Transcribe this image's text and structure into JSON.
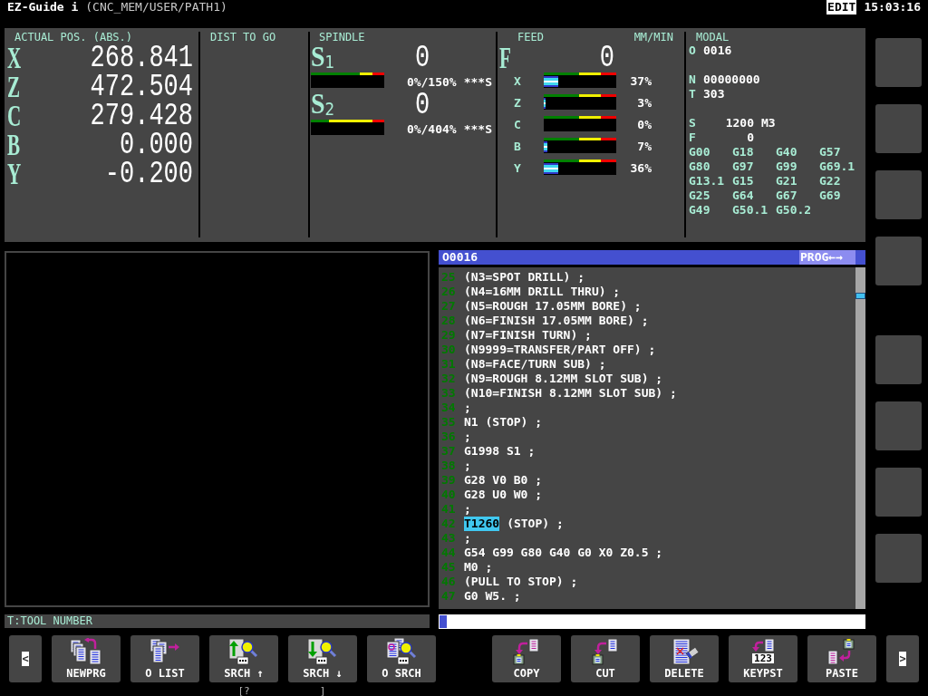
{
  "header": {
    "title": "EZ-Guide i",
    "path": "(CNC_MEM/USER/PATH1)",
    "mode": "EDIT",
    "time": "15:03:16"
  },
  "position": {
    "title": "ACTUAL POS. (ABS.)",
    "axes": [
      {
        "axis": "X",
        "value": "268.841"
      },
      {
        "axis": "Z",
        "value": "472.504"
      },
      {
        "axis": "C",
        "value": "279.428"
      },
      {
        "axis": "B",
        "value": "0.000"
      },
      {
        "axis": "Y",
        "value": "-0.200"
      }
    ]
  },
  "distance_to_go": {
    "title": "DIST TO GO"
  },
  "spindle": {
    "title": "SPINDLE",
    "spindles": [
      {
        "label": "S$_{1}$",
        "speed": "0",
        "load": "0%/150%",
        "status": "***S"
      },
      {
        "label": "S$_{2}$",
        "speed": "0",
        "load": "0%/404%",
        "status": "***S"
      }
    ]
  },
  "feed": {
    "title": "FEED",
    "unit": "MM/MIN",
    "label": "F",
    "value": "0",
    "axes": [
      {
        "axis": "X",
        "level": 0.2,
        "percent": "37%"
      },
      {
        "axis": "Z",
        "level": 0.025,
        "percent": "3%"
      },
      {
        "axis": "C",
        "percent": "0%"
      },
      {
        "axis": "B",
        "level": 0.05,
        "percent": "7%"
      },
      {
        "axis": "Y",
        "level": 0.2,
        "percent": "36%"
      }
    ]
  },
  "modal": {
    "title": "MODAL",
    "blocks": [
      {
        "lines": [
          {
            "kind": "address",
            "address": "O",
            "value": "0016"
          }
        ]
      },
      {
        "lines": [
          {
            "kind": "address",
            "address": "N",
            "value": "00000000"
          },
          {
            "kind": "address",
            "address": "T",
            "value": "303"
          }
        ]
      },
      {
        "lines": [
          {
            "kind": "command",
            "address": "S",
            "value": "1200",
            "code": "M3"
          },
          {
            "kind": "command",
            "address": "F",
            "value": "0"
          }
        ]
      }
    ],
    "g_codes": [
      "G00",
      "G18",
      "G40",
      "G57",
      "G80",
      "G97",
      "G99",
      "G69.1",
      "G13.1",
      "G15",
      "G21",
      "G22",
      "G25",
      "G64",
      "G67",
      "G69",
      "G49",
      "G50.1",
      "G50.2"
    ]
  },
  "program": {
    "title": "O0016",
    "mode": "PROG←→",
    "lines": [
      {
        "number": "25",
        "text": "(N3=SPOT DRILL) ;"
      },
      {
        "number": "26",
        "text": "(N4=16MM DRILL THRU) ;"
      },
      {
        "number": "27",
        "text": "(N5=ROUGH 17.05MM BORE) ;"
      },
      {
        "number": "28",
        "text": "(N6=FINISH 17.05MM BORE) ;"
      },
      {
        "number": "29",
        "text": "(N7=FINISH TURN) ;"
      },
      {
        "number": "30",
        "text": "(N9999=TRANSFER/PART OFF) ;"
      },
      {
        "number": "31",
        "text": "(N8=FACE/TURN SUB) ;"
      },
      {
        "number": "32",
        "text": "(N9=ROUGH 8.12MM SLOT SUB) ;"
      },
      {
        "number": "33",
        "text": "(N10=FINISH 8.12MM SLOT SUB) ;"
      },
      {
        "number": "34",
        "text": ";"
      },
      {
        "number": "35",
        "text": "N1 (STOP) ;"
      },
      {
        "number": "36",
        "text": ";"
      },
      {
        "number": "37",
        "text": "G1998 S1 ;"
      },
      {
        "number": "38",
        "text": ";"
      },
      {
        "number": "39",
        "text": "G28 V0 B0 ;"
      },
      {
        "number": "40",
        "text": "G28 U0 W0 ;"
      },
      {
        "number": "41",
        "text": ";"
      },
      {
        "number": "42",
        "highlight": "T1260",
        "text": "(STOP) ;"
      },
      {
        "number": "43",
        "text": ";"
      },
      {
        "number": "44",
        "text": "G54 G99 G80 G40 G0 X0 Z0.5 ;"
      },
      {
        "number": "45",
        "text": "M0 ;"
      },
      {
        "number": "46",
        "text": "(PULL TO STOP) ;"
      },
      {
        "number": "47",
        "text": "G0 W5. ;"
      }
    ]
  },
  "message": "T:TOOL NUMBER",
  "side_keys": {
    "upper": [
      {
        "kind": "blank"
      },
      {
        "kind": "blank"
      },
      {
        "kind": "blank"
      },
      {
        "kind": "blank"
      }
    ],
    "lower": [
      {
        "kind": "blank"
      },
      {
        "kind": "blank"
      },
      {
        "kind": "blank"
      },
      {
        "kind": "blank"
      }
    ]
  },
  "softkeys": {
    "left": [
      {
        "kind": "back",
        "label": "<"
      },
      {
        "kind": "newprg",
        "label": "NEWPRG"
      },
      {
        "kind": "olist",
        "label": "O LIST"
      },
      {
        "kind": "searchup",
        "label": "SRCH ↑",
        "hint": "[?"
      },
      {
        "kind": "searchdown",
        "label": "SRCH ↓",
        "hint": "]"
      },
      {
        "kind": "osearch",
        "label": "O SRCH"
      }
    ],
    "right": [
      {
        "kind": "copy",
        "label": "COPY"
      },
      {
        "kind": "cut",
        "label": "CUT"
      },
      {
        "kind": "delete",
        "label": "DELETE"
      },
      {
        "kind": "keypaste",
        "label": "KEYPST",
        "icon_text": "123"
      },
      {
        "kind": "paste",
        "label": "PASTE"
      },
      {
        "kind": "next",
        "label": ">"
      }
    ]
  }
}
